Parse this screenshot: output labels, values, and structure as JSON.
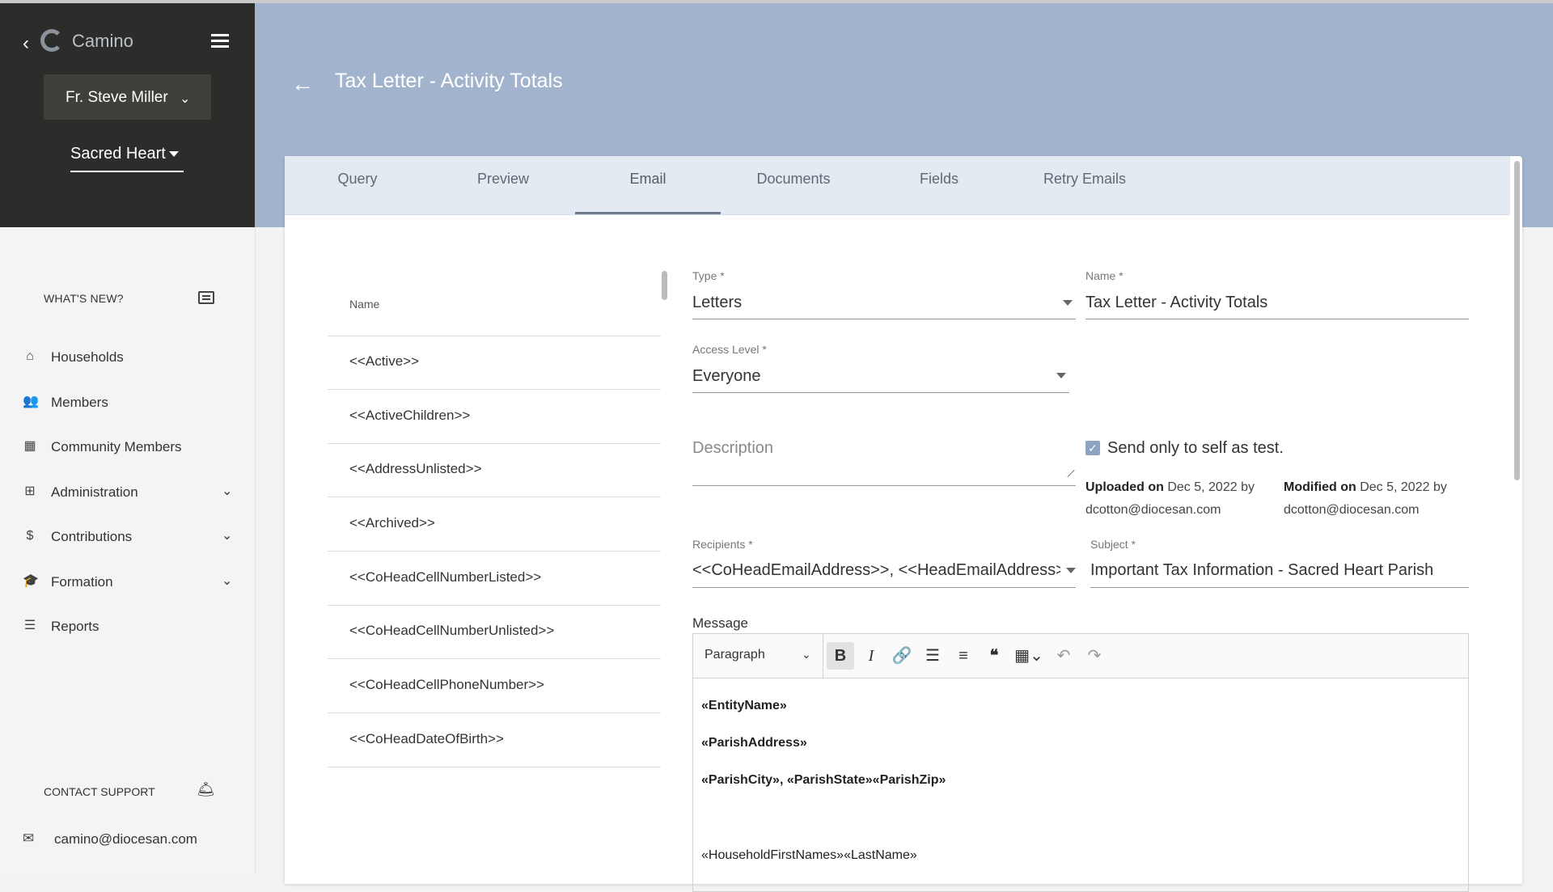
{
  "app": {
    "brand": "Camino",
    "user": "Fr. Steve Miller",
    "parish": "Sacred Heart"
  },
  "sidebar": {
    "whats_new": "WHAT'S NEW?",
    "items": [
      {
        "label": "Households",
        "icon": "home-icon"
      },
      {
        "label": "Members",
        "icon": "people-icon"
      },
      {
        "label": "Community Members",
        "icon": "building-icon"
      },
      {
        "label": "Administration",
        "icon": "dashboard-icon",
        "expandable": true
      },
      {
        "label": "Contributions",
        "icon": "dollar-icon",
        "expandable": true
      },
      {
        "label": "Formation",
        "icon": "graduation-cap-icon",
        "expandable": true
      },
      {
        "label": "Reports",
        "icon": "report-icon"
      }
    ],
    "contact_support": "CONTACT SUPPORT",
    "support_email": "camino@diocesan.com"
  },
  "page": {
    "title": "Tax Letter - Activity Totals"
  },
  "tabs": [
    {
      "label": "Query"
    },
    {
      "label": "Preview"
    },
    {
      "label": "Email",
      "active": true
    },
    {
      "label": "Documents"
    },
    {
      "label": "Fields"
    },
    {
      "label": "Retry Emails"
    }
  ],
  "field_list": {
    "header": "Name",
    "items": [
      "<<Active>>",
      "<<ActiveChildren>>",
      "<<AddressUnlisted>>",
      "<<Archived>>",
      "<<CoHeadCellNumberListed>>",
      "<<CoHeadCellNumberUnlisted>>",
      "<<CoHeadCellPhoneNumber>>",
      "<<CoHeadDateOfBirth>>"
    ]
  },
  "form": {
    "type_label": "Type *",
    "type_value": "Letters",
    "name_label": "Name *",
    "name_value": "Tax Letter - Activity Totals",
    "access_label": "Access Level *",
    "access_value": "Everyone",
    "description_placeholder": "Description",
    "send_self_label": "Send only to self as test.",
    "send_self_checked": true,
    "uploaded_label": "Uploaded on",
    "uploaded_date": "Dec 5, 2022 by",
    "uploaded_by": "dcotton@diocesan.com",
    "modified_label": "Modified on",
    "modified_date": "Dec 5, 2022 by",
    "modified_by": "dcotton@diocesan.com",
    "recipients_label": "Recipients *",
    "recipients_value": "<<CoHeadEmailAddress>>, <<HeadEmailAddress>>...",
    "subject_label": "Subject *",
    "subject_value": "Important Tax Information - Sacred Heart Parish",
    "message_label": "Message"
  },
  "editor": {
    "block_format": "Paragraph",
    "lines": [
      "«EntityName»",
      "«ParishAddress»",
      "«ParishCity», «ParishState»«ParishZip»",
      "«HouseholdFirstNames»«LastName»"
    ]
  },
  "colors": {
    "sidebar_header": "#2c2d2a",
    "page_header": "#a2b4cd",
    "tab_bar": "#e4eaf1",
    "checkbox": "#8da3c2"
  }
}
